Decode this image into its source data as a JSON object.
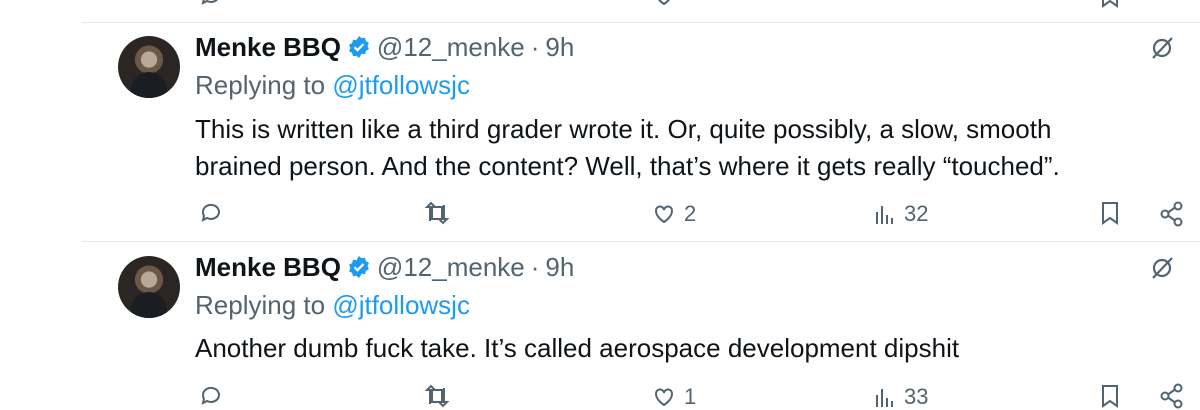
{
  "tweets": [
    {
      "name": "Menke BBQ",
      "handle": "@12_menke",
      "separator": "·",
      "time": "9h",
      "replying_prefix": "Replying to ",
      "replying_user": "@jtfollowsjc",
      "text_line1": "This is written like a third grader wrote it. Or, quite possibly, a slow, smooth",
      "text_line2": "brained person. And the content? Well, that’s where it gets really “touched”.",
      "likes": "2",
      "views": "32"
    },
    {
      "name": "Menke BBQ",
      "handle": "@12_menke",
      "separator": "·",
      "time": "9h",
      "replying_prefix": "Replying to ",
      "replying_user": "@jtfollowsjc",
      "text_line1": "Another dumb fuck take. It’s called aerospace development dipshit",
      "likes": "1",
      "views": "33"
    }
  ],
  "colors": {
    "accent": "#1d9bf0",
    "muted": "#536471",
    "text": "#0f1419"
  },
  "icons": [
    "reply-icon",
    "retweet-icon",
    "like-icon",
    "views-icon",
    "bookmark-icon",
    "share-icon",
    "verified-badge-icon",
    "grok-icon"
  ]
}
